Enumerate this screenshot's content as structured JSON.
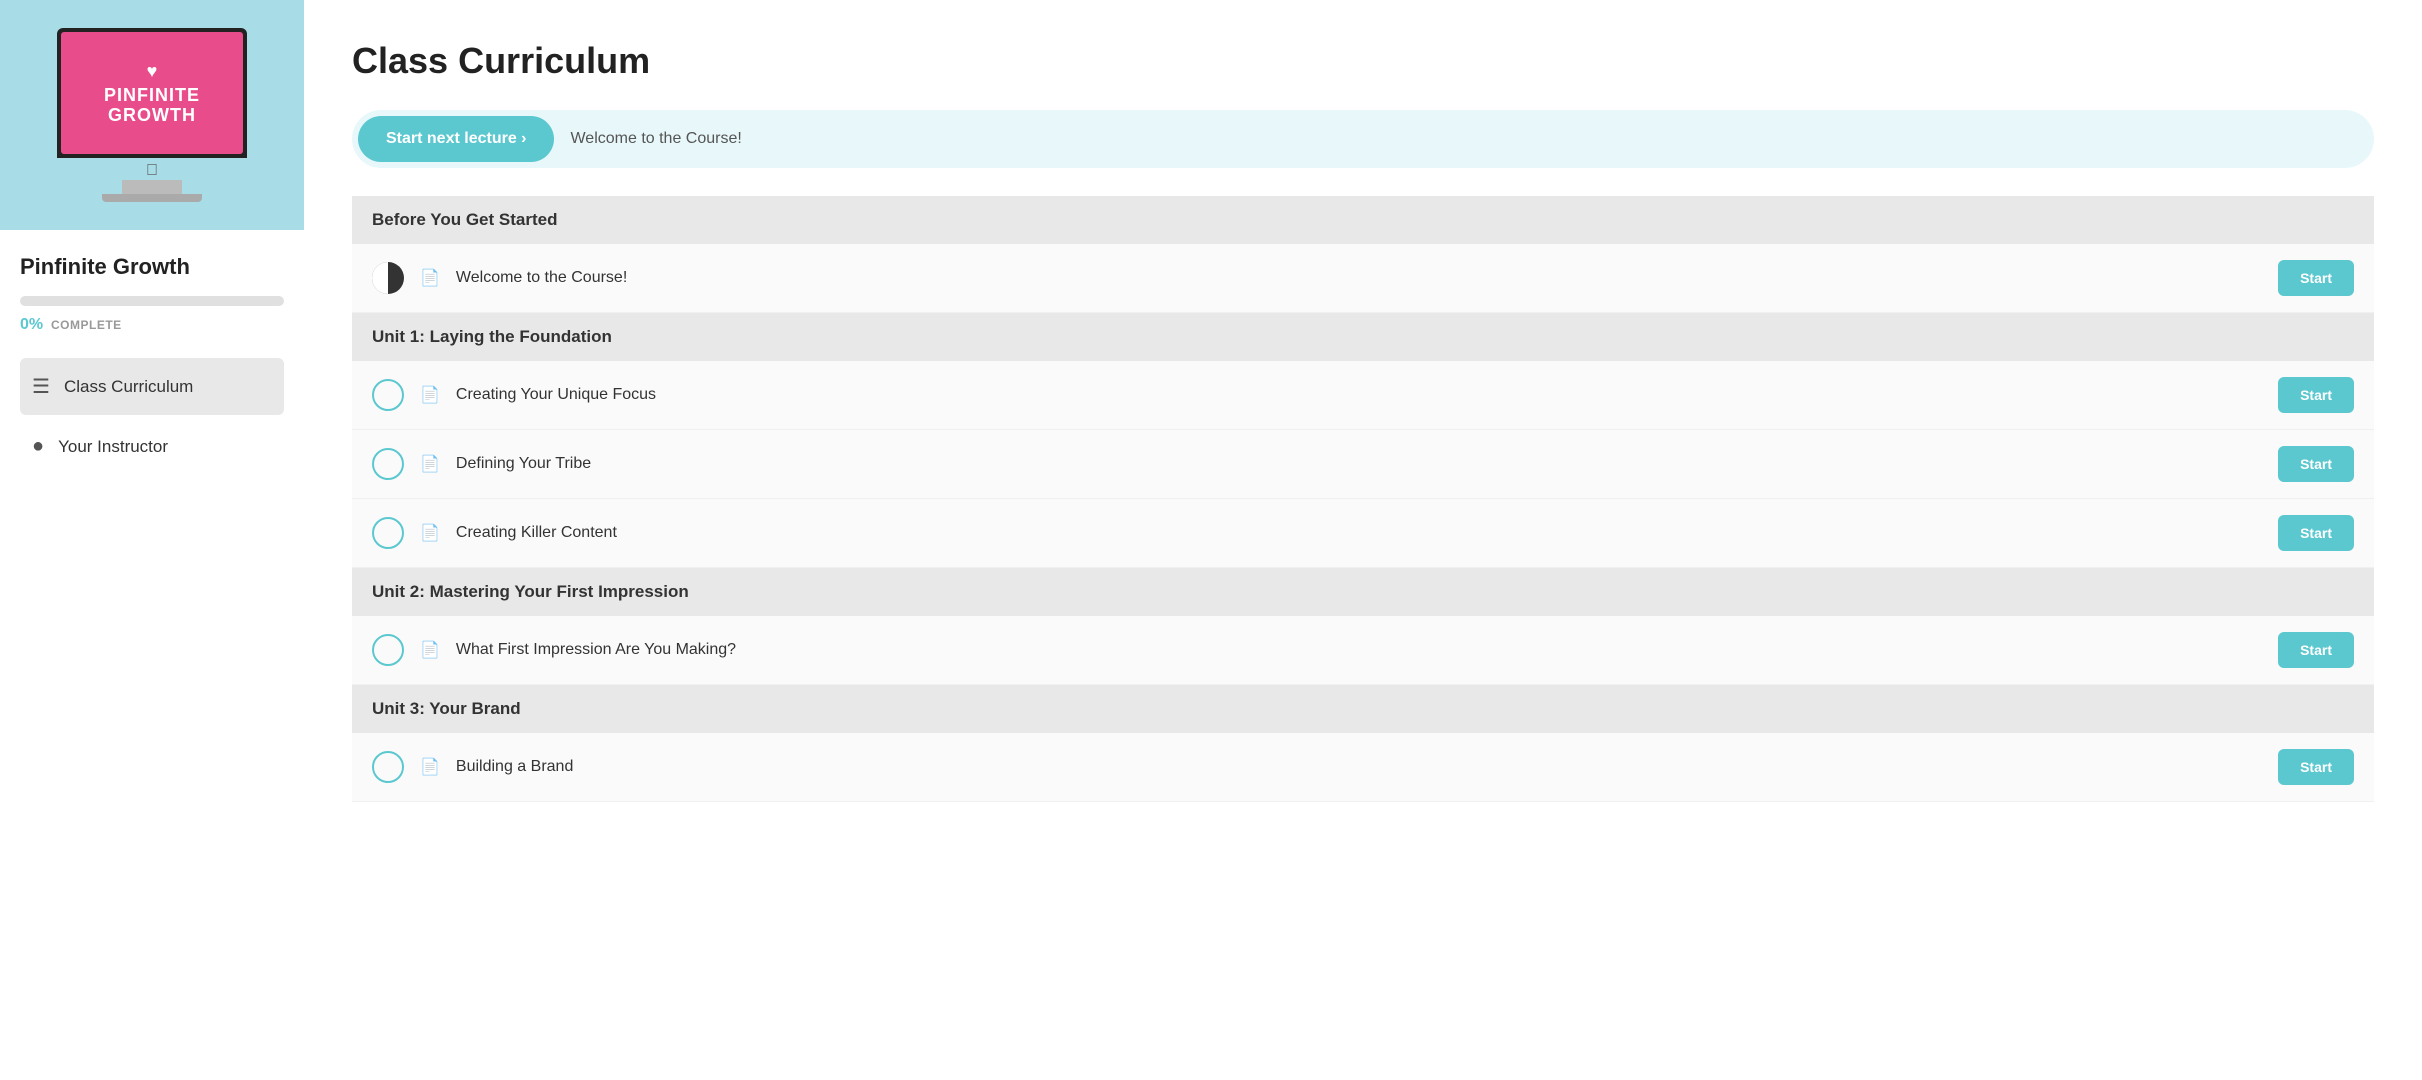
{
  "sidebar": {
    "course_title": "Pinfinite Growth",
    "monitor_line1": "PINFINITE",
    "monitor_line2": "GROWTH",
    "progress_percent": "0%",
    "complete_label": "COMPLETE",
    "nav_items": [
      {
        "id": "curriculum",
        "icon": "list-icon",
        "label": "Class Curriculum",
        "active": true
      },
      {
        "id": "instructor",
        "icon": "person-icon",
        "label": "Your Instructor",
        "active": false
      }
    ]
  },
  "main": {
    "page_title": "Class Curriculum",
    "next_lecture": {
      "button_label": "Start next lecture ›",
      "lecture_name": "Welcome to the Course!"
    },
    "sections": [
      {
        "id": "before-get-started",
        "title": "Before You Get Started",
        "lessons": [
          {
            "id": "welcome",
            "title": "Welcome to the Course!",
            "icon": "doc-icon",
            "status": "half",
            "button": "Start"
          }
        ]
      },
      {
        "id": "unit-1",
        "title": "Unit 1: Laying the Foundation",
        "lessons": [
          {
            "id": "unique-focus",
            "title": "Creating Your Unique Focus",
            "icon": "doc-icon",
            "status": "empty",
            "button": "Start"
          },
          {
            "id": "define-tribe",
            "title": "Defining Your Tribe",
            "icon": "doc-icon",
            "status": "empty",
            "button": "Start"
          },
          {
            "id": "killer-content",
            "title": "Creating Killer Content",
            "icon": "doc-icon",
            "status": "empty",
            "button": "Start"
          }
        ]
      },
      {
        "id": "unit-2",
        "title": "Unit 2: Mastering Your First Impression",
        "lessons": [
          {
            "id": "first-impression",
            "title": "What First Impression Are You Making?",
            "icon": "doc-icon",
            "status": "empty",
            "button": "Start"
          }
        ]
      },
      {
        "id": "unit-3",
        "title": "Unit 3: Your Brand",
        "lessons": [
          {
            "id": "building-brand",
            "title": "Building a Brand",
            "icon": "doc-icon",
            "status": "empty",
            "button": "Start"
          }
        ]
      }
    ]
  }
}
